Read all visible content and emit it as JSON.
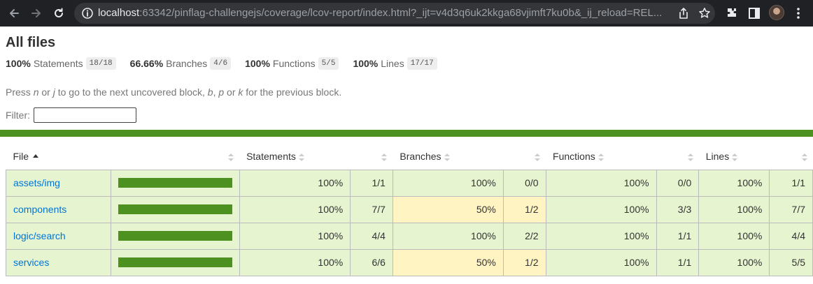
{
  "browser": {
    "url_host": "localhost",
    "url_rest": ":63342/pinflag-challengejs/coverage/lcov-report/index.html?_ijt=v4d3q6uk2kkga68vjimft7ku0b&_ij_reload=REL..."
  },
  "report": {
    "title": "All files",
    "summary": [
      {
        "pct": "100%",
        "label": "Statements",
        "fraction": "18/18"
      },
      {
        "pct": "66.66%",
        "label": "Branches",
        "fraction": "4/6"
      },
      {
        "pct": "100%",
        "label": "Functions",
        "fraction": "5/5"
      },
      {
        "pct": "100%",
        "label": "Lines",
        "fraction": "17/17"
      }
    ],
    "hint": {
      "p1": "Press ",
      "k1": "n",
      "p2": " or ",
      "k2": "j",
      "p3": " to go to the next uncovered block, ",
      "k3": "b",
      "p4": ", ",
      "k4": "p",
      "p5": " or ",
      "k5": "k",
      "p6": " for the previous block."
    },
    "filter_label": "Filter:",
    "filter_value": "",
    "columns": {
      "file": "File",
      "statements": "Statements",
      "branches": "Branches",
      "functions": "Functions",
      "lines": "Lines"
    },
    "rows": [
      {
        "file": "assets/img",
        "st_pct": "100%",
        "st": "1/1",
        "br_pct": "100%",
        "br": "0/0",
        "fn_pct": "100%",
        "fn": "0/0",
        "ln_pct": "100%",
        "ln": "1/1"
      },
      {
        "file": "components",
        "st_pct": "100%",
        "st": "7/7",
        "br_pct": "50%",
        "br": "1/2",
        "fn_pct": "100%",
        "fn": "3/3",
        "ln_pct": "100%",
        "ln": "7/7"
      },
      {
        "file": "logic/search",
        "st_pct": "100%",
        "st": "4/4",
        "br_pct": "100%",
        "br": "2/2",
        "fn_pct": "100%",
        "fn": "1/1",
        "ln_pct": "100%",
        "ln": "4/4"
      },
      {
        "file": "services",
        "st_pct": "100%",
        "st": "6/6",
        "br_pct": "50%",
        "br": "1/2",
        "fn_pct": "100%",
        "fn": "1/1",
        "ln_pct": "100%",
        "ln": "5/5"
      }
    ],
    "coverage_fill": 1.0
  },
  "colors": {
    "high": "#e6f5d0",
    "medium": "#fff4c2",
    "bar": "#4d9221",
    "link": "#0074d9"
  }
}
